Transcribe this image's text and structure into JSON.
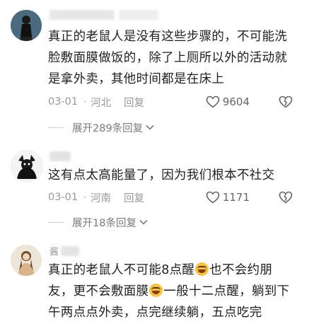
{
  "comments": [
    {
      "text": "真正的老鼠人是没有这些步骤的，不可能洗脸敷面膜做饭的，除了上厕所以外的活动就是拿外卖，其他时间都是在床上",
      "date": "03-01",
      "separator": "·",
      "region": "河北",
      "reply_label": "回复",
      "likes": "9604",
      "expand_label": "展开289条回复"
    },
    {
      "text": "这有点太高能量了，因为我们根本不社交",
      "date": "03-01",
      "separator": "·",
      "region": "河南",
      "reply_label": "回复",
      "likes": "1171",
      "expand_label": "展开18条回复"
    },
    {
      "username_prefix": "酱",
      "text_part1": "真正的老鼠人不可能8点醒",
      "text_part2": "也不会约朋友，更不会敷面膜",
      "text_part3": "一般十二点醒，躺到下午两点点外卖，点完继续躺，五点吃完"
    }
  ],
  "colors": {
    "text": "#1f1f1f",
    "meta": "#999999",
    "background": "#ffffff"
  }
}
